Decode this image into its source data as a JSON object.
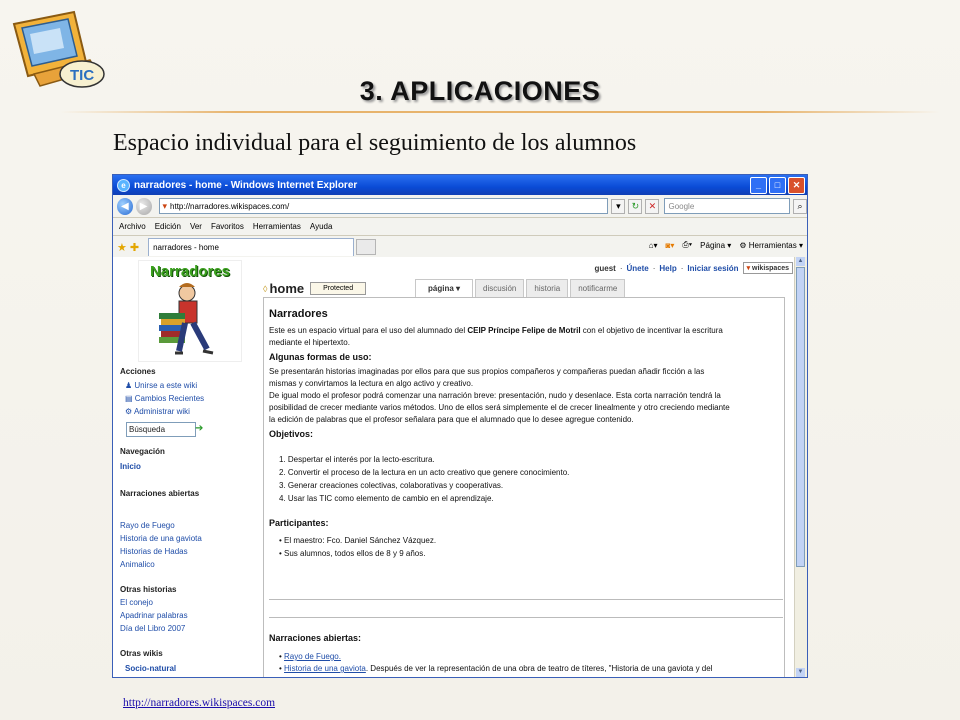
{
  "slide": {
    "title": "3. APLICACIONES",
    "subtitle": "Espacio individual para el seguimiento de los alumnos",
    "footer_url": "http://narradores.wikispaces.com",
    "logo_text": "TIC"
  },
  "browser": {
    "window_title": "narradores - home - Windows Internet Explorer",
    "address": "http://narradores.wikispaces.com/",
    "search_placeholder": "Google",
    "menu": [
      "Archivo",
      "Edición",
      "Ver",
      "Favoritos",
      "Herramientas",
      "Ayuda"
    ],
    "tab_label": "narradores - home",
    "cmd_page": "Página",
    "cmd_tools": "Herramientas"
  },
  "site": {
    "logo_text": "Narradores",
    "top_links": {
      "user": "guest",
      "sep1": "·",
      "join": "Únete",
      "sep2": "·",
      "help": "Help",
      "sep3": "·",
      "login": "Iniciar sesión",
      "badge": "wikispaces"
    },
    "home_label": "home",
    "protected_label": "Protected",
    "page_tabs": [
      "página",
      "discusión",
      "historia",
      "notificarme"
    ],
    "sidebar": {
      "acciones": "Acciones",
      "acciones_items": [
        "Unirse a este wiki",
        "Cambios Recientes",
        "Administrar wiki"
      ],
      "search_value": "Búsqueda",
      "navegacion": "Navegación",
      "inicio": "Inicio",
      "narraciones_abiertas": "Narraciones abiertas",
      "narraciones_items": [
        "Rayo de Fuego",
        "Historia de una gaviota",
        "Historias de Hadas",
        "Animalico"
      ],
      "otras_historias": "Otras historias",
      "otras_items": [
        "El conejo",
        "Apadrinar palabras",
        "Día del Libro 2007"
      ],
      "otras_wikis": "Otras wikis",
      "socio": "Socio-natural"
    },
    "content": {
      "heading": "Narradores",
      "intro1a": "Este es un espacio virtual para el uso del alumnado del ",
      "intro1b": "CEIP Príncipe Felipe de Motril",
      "intro1c": " con el objetivo de incentivar la escritura",
      "intro2": "mediante el hipertexto.",
      "formas_title": "Algunas formas de uso:",
      "formas_lines": [
        "Se presentarán historias imaginadas por ellos para que sus propios compañeros y compañeras puedan añadir ficción a las",
        "mismas y convirtamos la lectura en algo activo y creativo.",
        "De igual modo el profesor podrá comenzar una narración breve: presentación, nudo y desenlace. Esta corta narración tendrá la",
        "posibilidad de crecer mediante varios métodos. Uno de ellos será simplemente el de crecer linealmente y otro creciendo mediante",
        "la edición de palabras que el profesor señalara para que el alumnado que lo desee agregue contenido."
      ],
      "objetivos_title": "Objetivos:",
      "objetivos": [
        "1.   Despertar el interés por la lecto-escritura.",
        "2.   Convertir el proceso de la lectura en un acto creativo que genere conocimiento.",
        "3.   Generar creaciones colectivas, colaborativas y cooperativas.",
        "4.   Usar las TIC como elemento de cambio en el aprendizaje."
      ],
      "participantes_title": "Participantes:",
      "participantes": [
        "•   El maestro: Fco. Daniel Sánchez Vázquez.",
        "•   Sus alumnos, todos ellos de 8 y 9 años."
      ],
      "narr_title": "Narraciones abiertas:",
      "narr_item1": "Rayo de Fuego.",
      "narr_item2_link": "Historia de una gaviota",
      "narr_item2_rest": ". Después de ver la representación de una obra de teatro de títeres, \"Historia de una gaviota y del"
    }
  }
}
